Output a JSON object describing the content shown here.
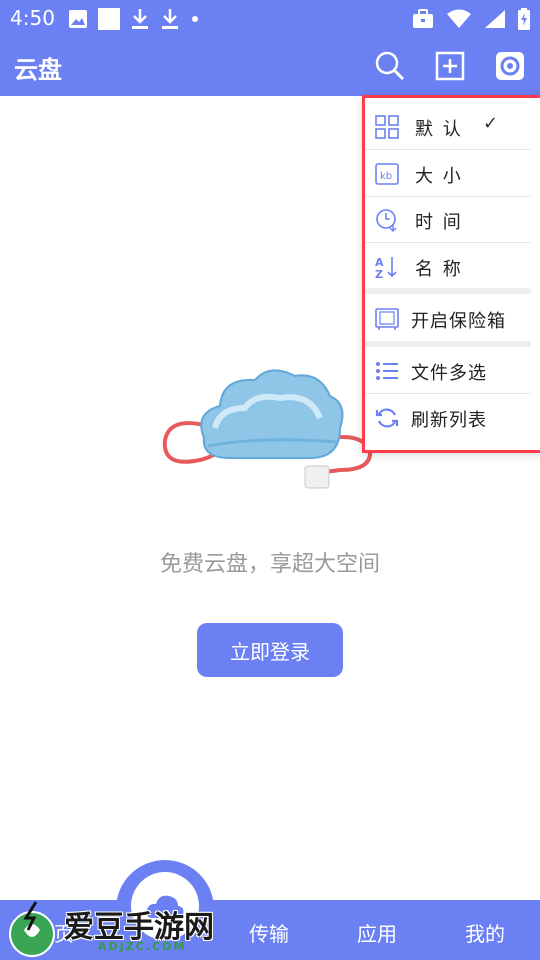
{
  "status_bar": {
    "time": "4:50"
  },
  "header": {
    "title": "云盘"
  },
  "menu": {
    "items": [
      {
        "label": "默 认",
        "icon": "grid-icon",
        "checked": "✓"
      },
      {
        "label": "大 小",
        "icon": "kb-icon"
      },
      {
        "label": "时 间",
        "icon": "clock-icon"
      },
      {
        "label": "名 称",
        "icon": "sort-az-icon"
      },
      {
        "label": "开启保险箱",
        "icon": "safe-icon"
      },
      {
        "label": "文件多选",
        "icon": "list-icon"
      },
      {
        "label": "刷新列表",
        "icon": "refresh-icon"
      }
    ]
  },
  "main": {
    "empty_text": "免费云盘，享超大空间",
    "login_button": "立即登录"
  },
  "bottom_nav": {
    "tabs": [
      "首页",
      "传输",
      "应用",
      "我的"
    ]
  },
  "watermark": {
    "text": "爱豆手游网",
    "sub": "ADJZC.COM"
  },
  "colors": {
    "primary": "#6b80f3",
    "highlight_border": "#ff3d4c"
  }
}
